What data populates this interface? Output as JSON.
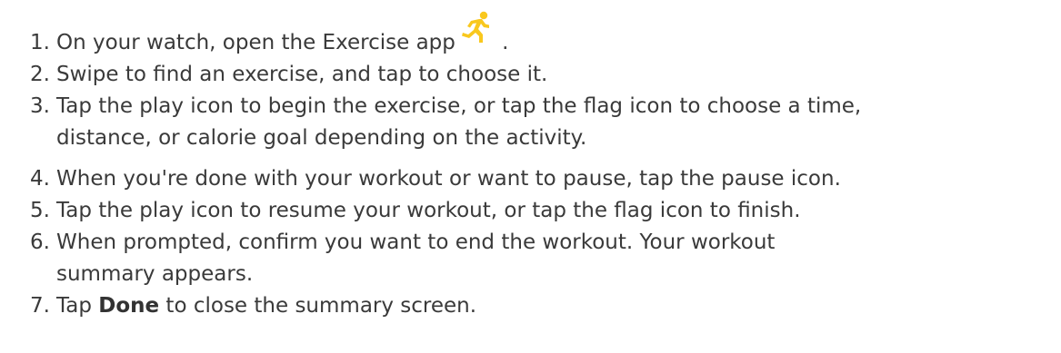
{
  "steps": [
    {
      "number": "1.",
      "text": "On your watch, open the Exercise app",
      "icon": "exercise-app-icon",
      "after_icon": " ."
    },
    {
      "number": "2.",
      "text": "Swipe to find an exercise, and tap to choose it."
    },
    {
      "number": "3.",
      "line1": "Tap the play icon to begin the exercise, or tap the flag icon to choose a time,",
      "line2": "distance, or calorie goal depending on the activity."
    },
    {
      "number": "4.",
      "text": "When you're done with your workout or want to pause, tap the pause icon."
    },
    {
      "number": "5.",
      "text": "Tap the play icon to resume your workout, or tap the flag icon to finish."
    },
    {
      "number": "6.",
      "line1": "When prompted, confirm you want to end the workout. Your workout",
      "line2": "summary appears."
    },
    {
      "number": "7.",
      "before": "Tap ",
      "bold": "Done",
      "after": " to close the summary screen."
    }
  ],
  "colors": {
    "text": "#3a3a3a",
    "icon_yellow": "#f9c81e"
  }
}
